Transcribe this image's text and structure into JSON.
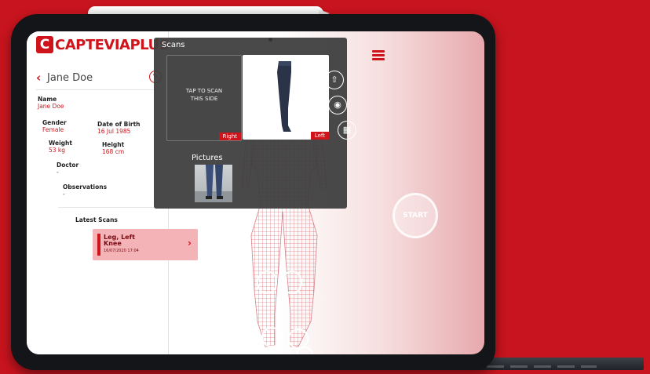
{
  "app": {
    "logo_mark": "C",
    "logo_text": "CAPTEVIAPLUS"
  },
  "patient": {
    "header_name": "Jane Doe",
    "name_label": "Name",
    "name_value": "Jane Doe",
    "gender_label": "Gender",
    "gender_value": "Female",
    "dob_label": "Date of Birth",
    "dob_value": "16 Jul 1985",
    "weight_label": "Weight",
    "weight_value": "53 kg",
    "height_label": "Height",
    "height_value": "168 cm",
    "doctor_label": "Doctor",
    "doctor_value": "-",
    "observations_label": "Observations",
    "observations_value": "-"
  },
  "latest_scans": {
    "label": "Latest Scans",
    "items": [
      {
        "line1": "Leg, Left",
        "line2": "Knee",
        "date": "16/07/2020 17:04"
      }
    ]
  },
  "scans": {
    "title": "Scans",
    "right_tile": {
      "message_line1": "TAP TO SCAN",
      "message_line2": "THIS SIDE",
      "tag": "Right"
    },
    "left_tile": {
      "tag": "Left"
    },
    "pictures_title": "Pictures"
  },
  "actions": {
    "upload_icon": "cloud-upload-icon",
    "camera_icon": "camera-icon",
    "grid_icon": "grid-icon"
  },
  "start_label": "START",
  "colors": {
    "brand_red": "#d0141c",
    "background_red": "#c8141e",
    "panel_dark": "#3e3e3e"
  }
}
